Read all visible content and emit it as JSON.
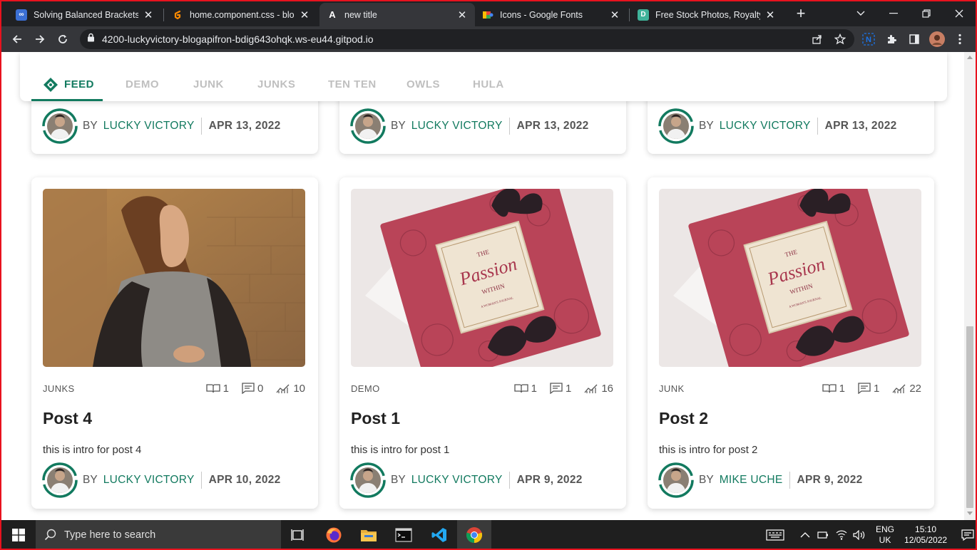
{
  "browser": {
    "tabs": [
      {
        "title": "Solving Balanced Brackets in",
        "favicon": "infinity-icon",
        "color": "#3b6fd4",
        "active": false
      },
      {
        "title": "home.component.css - blog-",
        "favicon": "gitpod-icon",
        "color": "#ff8a00",
        "active": false
      },
      {
        "title": "new title",
        "favicon": "angular-icon",
        "color": "#35363a",
        "active": true
      },
      {
        "title": "Icons - Google Fonts",
        "favicon": "google-fonts-icon",
        "color": "#4285f4",
        "active": false
      },
      {
        "title": "Free Stock Photos, Royalty Fr",
        "favicon": "pexels-icon",
        "color": "#3fb39a",
        "active": false
      }
    ],
    "url": "4200-luckyvictory-blogapifron-bdig643ohqk.ws-eu44.gitpod.io"
  },
  "nav": {
    "items": [
      "FEED",
      "DEMO",
      "JUNK",
      "JUNKS",
      "TEN TEN",
      "OWLS",
      "HULA"
    ],
    "active": "FEED"
  },
  "top_cards": [
    {
      "by": "BY",
      "author": "LUCKY VICTORY",
      "date": "APR 13, 2022"
    },
    {
      "by": "BY",
      "author": "LUCKY VICTORY",
      "date": "APR 13, 2022"
    },
    {
      "by": "BY",
      "author": "LUCKY VICTORY",
      "date": "APR 13, 2022"
    }
  ],
  "posts": [
    {
      "category": "JUNKS",
      "reads": "1",
      "comments": "0",
      "views": "10",
      "title": "Post 4",
      "intro": "this is intro for post 4",
      "by": "BY",
      "author": "LUCKY VICTORY",
      "date": "APR 10, 2022",
      "image": "woman-photo"
    },
    {
      "category": "DEMO",
      "reads": "1",
      "comments": "1",
      "views": "16",
      "title": "Post 1",
      "intro": "this is intro for post 1",
      "by": "BY",
      "author": "LUCKY VICTORY",
      "date": "APR 9, 2022",
      "image": "journal-photo"
    },
    {
      "category": "JUNK",
      "reads": "1",
      "comments": "1",
      "views": "22",
      "title": "Post 2",
      "intro": "this is intro for post 2",
      "by": "BY",
      "author": "MIKE UCHE",
      "date": "APR 9, 2022",
      "image": "journal-photo"
    }
  ],
  "journal_cover": {
    "line1": "THE",
    "line2": "Passion",
    "line3": "WITHIN",
    "line4": "A WOMAN'S JOURNAL"
  },
  "taskbar": {
    "search_placeholder": "Type here to search",
    "lang1": "ENG",
    "lang2": "UK",
    "time": "15:10",
    "date": "12/05/2022"
  },
  "colors": {
    "accent": "#127a5f",
    "frame": "#e8121e",
    "inactive_nav": "#bfbfbf"
  }
}
